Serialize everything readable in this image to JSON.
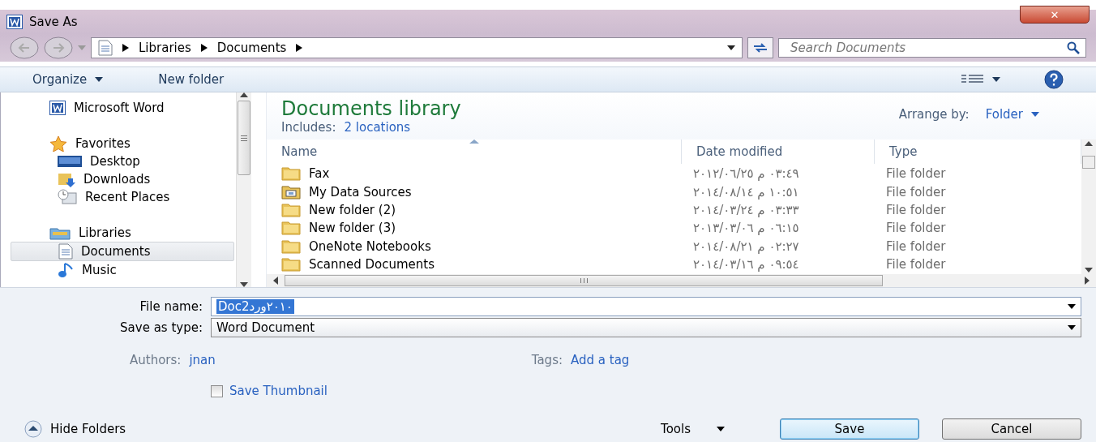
{
  "window": {
    "title": "Save As",
    "close": "✕"
  },
  "address": {
    "path": [
      "Libraries",
      "Documents"
    ],
    "search_placeholder": "Search Documents"
  },
  "toolbar": {
    "organize": "Organize",
    "new_folder": "New folder"
  },
  "nav": [
    {
      "label": "Microsoft Word",
      "kind": "word",
      "selected": false
    },
    {
      "label": "Favorites",
      "kind": "favorites",
      "selected": false,
      "children": [
        {
          "label": "Desktop",
          "kind": "desktop",
          "selected": false
        },
        {
          "label": "Downloads",
          "kind": "downloads",
          "selected": false
        },
        {
          "label": "Recent Places",
          "kind": "recent",
          "selected": false
        }
      ]
    },
    {
      "label": "Libraries",
      "kind": "libraries",
      "selected": false,
      "children": [
        {
          "label": "Documents",
          "kind": "documents",
          "selected": true
        },
        {
          "label": "Music",
          "kind": "music",
          "selected": false
        }
      ]
    }
  ],
  "library": {
    "title": "Documents library",
    "includes_label": "Includes:",
    "includes_link": "2 locations",
    "arrange_label": "Arrange by:",
    "arrange_value": "Folder"
  },
  "table": {
    "columns": [
      {
        "label": "Name",
        "sorted": true
      },
      {
        "label": "Date modified",
        "sorted": false
      },
      {
        "label": "Type",
        "sorted": false
      }
    ],
    "rows": [
      {
        "name": "Fax",
        "kind": "folder",
        "date": "٠٣:٤٩ م ٢٠١٢/٠٦/٢٥",
        "type": "File folder"
      },
      {
        "name": "My Data Sources",
        "kind": "datasource",
        "date": "١٠:٥١ م ٢٠١٤/٠٨/١٤",
        "type": "File folder"
      },
      {
        "name": "New folder (2)",
        "kind": "folder",
        "date": "٠٣:٣٣ م ٢٠١٤/٠٣/٢٤",
        "type": "File folder"
      },
      {
        "name": "New folder (3)",
        "kind": "folder",
        "date": "٠٦:١٥ م ٢٠١٣/٠٣/٠٦",
        "type": "File folder"
      },
      {
        "name": "OneNote Notebooks",
        "kind": "folder",
        "date": "٠٢:٢٧ م ٢٠١٤/٠٨/٢١",
        "type": "File folder"
      },
      {
        "name": "Scanned Documents",
        "kind": "folder",
        "date": "٠٩:٥٤ م ٢٠١٤/٠٣/١٦",
        "type": "File folder"
      }
    ]
  },
  "form": {
    "file_name_label": "File name:",
    "file_name": "Doc٢٠١٠ورد2",
    "type_label": "Save as type:",
    "type_value": "Word Document",
    "authors_label": "Authors:",
    "authors": "jnan",
    "tags_label": "Tags:",
    "tags": "Add a tag",
    "thumbnail": {
      "label": "Save Thumbnail",
      "checked": false
    }
  },
  "footer": {
    "hide_folders": "Hide Folders",
    "tools": "Tools",
    "buttons": [
      {
        "label": "Save",
        "default": true
      },
      {
        "label": "Cancel",
        "default": false
      }
    ]
  }
}
